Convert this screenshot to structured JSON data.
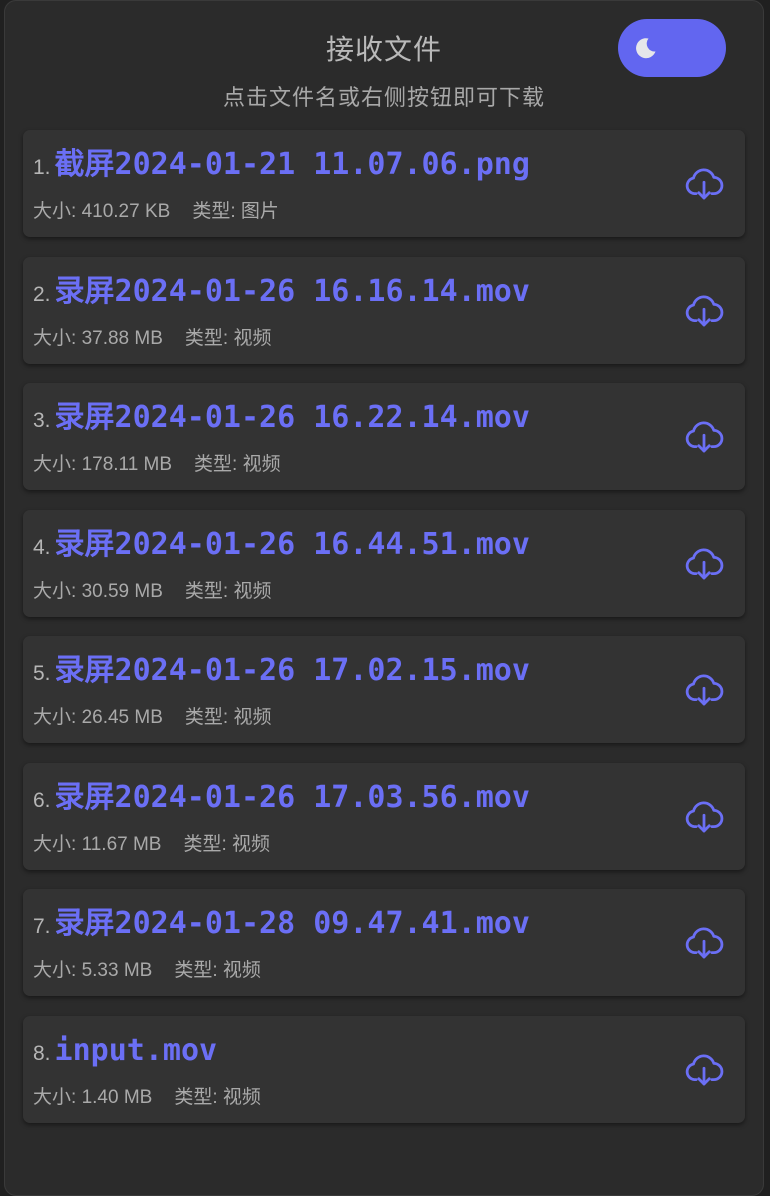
{
  "header": {
    "title": "接收文件",
    "subtitle": "点击文件名或右侧按钮即可下载"
  },
  "theme_toggle": {
    "icon": "moon-icon",
    "state": "dark",
    "accent": "#6266f0"
  },
  "colors": {
    "accent": "#6b6ff5",
    "background": "#2b2b2b",
    "card": "#333333",
    "text_muted": "#a9a9a9"
  },
  "files": [
    {
      "index": "1.",
      "name": "截屏2024-01-21 11.07.06.png",
      "size_label": "大小:",
      "size": "410.27 KB",
      "type_label": "类型:",
      "type": "图片"
    },
    {
      "index": "2.",
      "name": "录屏2024-01-26 16.16.14.mov",
      "size_label": "大小:",
      "size": "37.88 MB",
      "type_label": "类型:",
      "type": "视频"
    },
    {
      "index": "3.",
      "name": "录屏2024-01-26 16.22.14.mov",
      "size_label": "大小:",
      "size": "178.11 MB",
      "type_label": "类型:",
      "type": "视频"
    },
    {
      "index": "4.",
      "name": "录屏2024-01-26 16.44.51.mov",
      "size_label": "大小:",
      "size": "30.59 MB",
      "type_label": "类型:",
      "type": "视频"
    },
    {
      "index": "5.",
      "name": "录屏2024-01-26 17.02.15.mov",
      "size_label": "大小:",
      "size": "26.45 MB",
      "type_label": "类型:",
      "type": "视频"
    },
    {
      "index": "6.",
      "name": "录屏2024-01-26 17.03.56.mov",
      "size_label": "大小:",
      "size": "11.67 MB",
      "type_label": "类型:",
      "type": "视频"
    },
    {
      "index": "7.",
      "name": "录屏2024-01-28 09.47.41.mov",
      "size_label": "大小:",
      "size": "5.33 MB",
      "type_label": "类型:",
      "type": "视频"
    },
    {
      "index": "8.",
      "name": "input.mov",
      "size_label": "大小:",
      "size": "1.40 MB",
      "type_label": "类型:",
      "type": "视频"
    }
  ]
}
